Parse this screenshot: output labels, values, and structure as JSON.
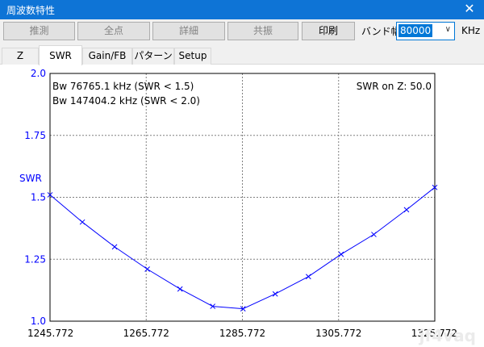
{
  "window": {
    "title": "周波数特性",
    "close_glyph": "✕"
  },
  "toolbar": {
    "estimate_label": "推測",
    "all_points_label": "全点",
    "detail_label": "詳細",
    "resonance_label": "共振",
    "print_label": "印刷",
    "bandwidth_label": "バンド幅",
    "bandwidth_value": "80000",
    "bandwidth_unit": "KHz"
  },
  "tabs": [
    "Z",
    "SWR",
    "Gain/FB",
    "パターン",
    "Setup"
  ],
  "active_tab": "SWR",
  "watermark": "jf4vaq",
  "chart_data": {
    "type": "line",
    "ylabel": "SWR",
    "xlim": [
      1245.772,
      1325.772
    ],
    "ylim": [
      1.0,
      2.0
    ],
    "x_ticks": [
      1245.772,
      1265.772,
      1285.772,
      1305.772,
      1325.772
    ],
    "x_tick_labels": [
      "1245.772",
      "1265.772",
      "1285.772",
      "1305.772",
      "1325.772"
    ],
    "y_ticks": [
      1.0,
      1.25,
      1.5,
      1.75,
      2.0
    ],
    "y_tick_labels": [
      "1.0",
      "1.25",
      "1.5",
      "1.75",
      "2.0"
    ],
    "grid": true,
    "annotations": [
      "Bw 76765.1 kHz (SWR < 1.5)",
      "Bw 147404.2 kHz (SWR < 2.0)",
      "SWR on Z: 50.0"
    ],
    "series": [
      {
        "color": "#0000ff",
        "x": [
          1245.772,
          1252.5,
          1259.2,
          1266,
          1272.8,
          1279.6,
          1285.9,
          1292.6,
          1299.5,
          1306.3,
          1313.1,
          1319.9,
          1325.772
        ],
        "y": [
          1.51,
          1.4,
          1.3,
          1.21,
          1.13,
          1.06,
          1.05,
          1.11,
          1.18,
          1.27,
          1.35,
          1.45,
          1.54
        ]
      }
    ]
  }
}
